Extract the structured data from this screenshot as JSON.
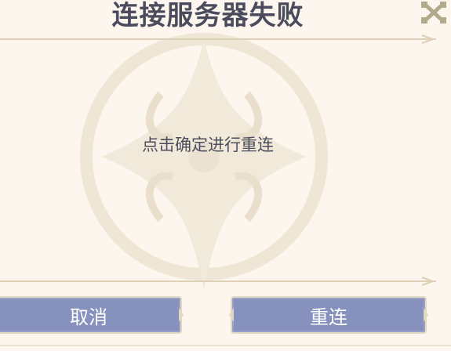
{
  "dialog": {
    "title": "连接服务器失败",
    "message": "点击确定进行重连"
  },
  "buttons": {
    "cancel_label": "取消",
    "reconnect_label": "重连"
  },
  "icons": {
    "close": "close-icon",
    "emblem": "compass-star-emblem-icon"
  },
  "colors": {
    "background": "#fcf6ee",
    "title_text": "#4a4c5e",
    "button_fill": "#8691bd",
    "button_text": "#ffffff",
    "ornament": "#d9cdb4"
  }
}
